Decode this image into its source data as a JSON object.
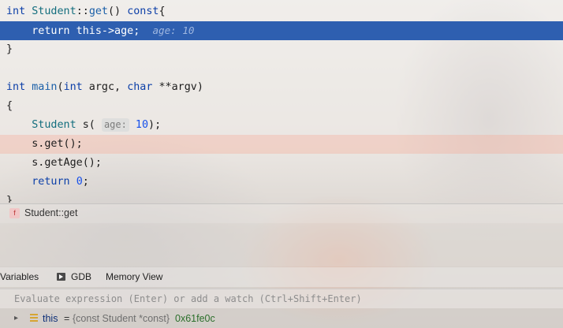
{
  "code_lines": {
    "l1": {
      "kw1": "int",
      "cls": "Student",
      "sep": "::",
      "fn": "get",
      "rest": "() ",
      "kw2": "const",
      "brace": "{"
    },
    "l2": {
      "kw": "return",
      "text": " this->age;",
      "hint": "age: 10"
    },
    "l3": {
      "text": "}"
    },
    "l5": {
      "kw1": "int",
      "fn": "main",
      "p1": "(",
      "kw2": "int",
      "p2": " argc, ",
      "kw3": "char",
      "p3": " **argv)"
    },
    "l6": {
      "text": "{"
    },
    "l7": {
      "ty": "Student",
      "p1": " s(",
      "inlay": "age:",
      "num": "10",
      "p2": ");"
    },
    "l8": {
      "text": "s.get();"
    },
    "l9": {
      "text": "s.getAge();"
    },
    "l10": {
      "kw": "return",
      "num": "0",
      "p": ";"
    },
    "l11": {
      "text": "}"
    }
  },
  "breadcrumb": {
    "icon_letter": "f",
    "label": "Student::get"
  },
  "debug_tabs": {
    "variables": "Variables",
    "gdb": "GDB",
    "memory": "Memory View"
  },
  "watch": {
    "placeholder": "Evaluate expression (Enter) or add a watch (Ctrl+Shift+Enter)"
  },
  "variables": [
    {
      "name": "this",
      "eq": "=",
      "type": "{const Student *const}",
      "value": "0x61fe0c"
    }
  ],
  "colors": {
    "exec_line": "#2e5fb0",
    "keyword": "#0c3fa8",
    "type": "#136e7e",
    "number": "#1750eb"
  }
}
